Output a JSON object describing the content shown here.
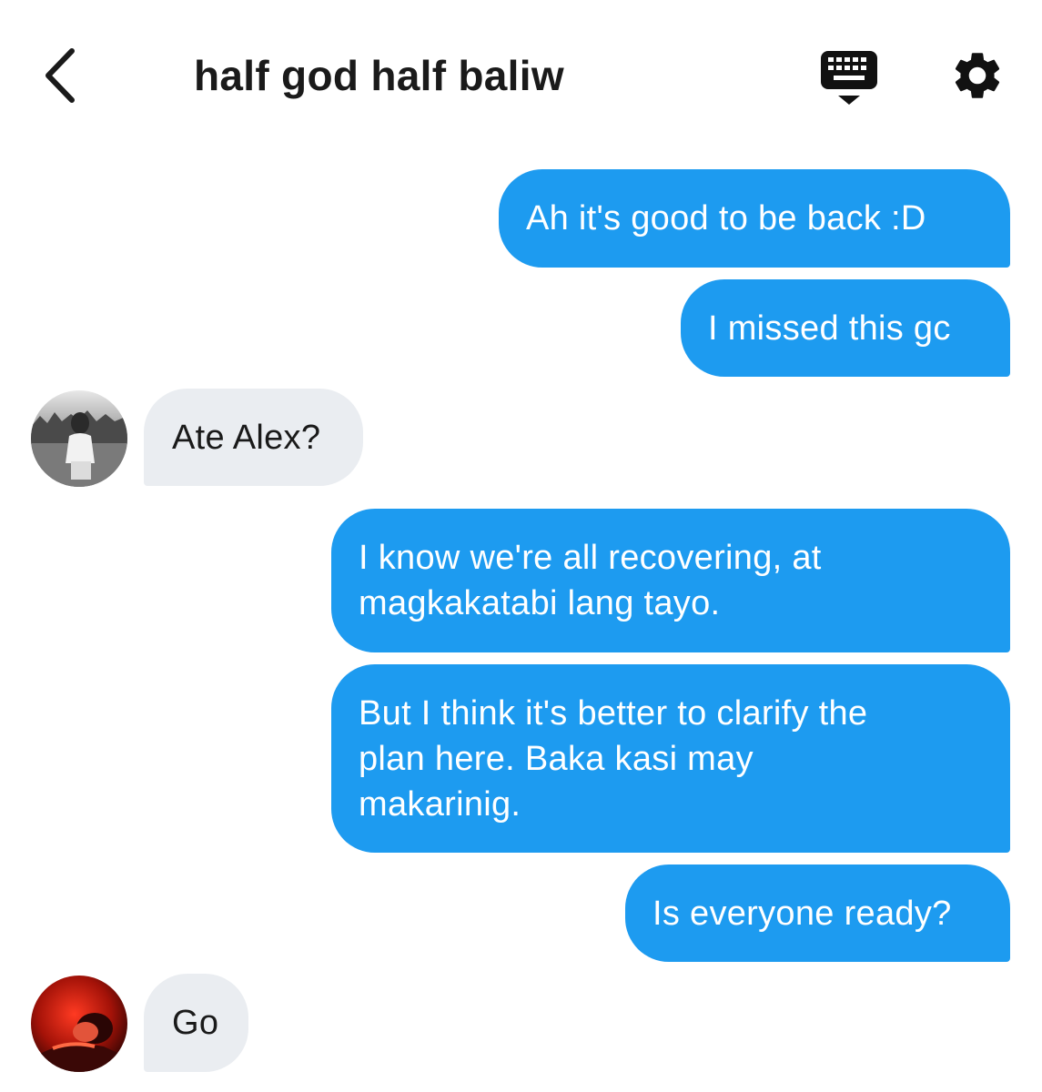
{
  "header": {
    "title": "half god half baliw",
    "back_icon": "chevron-left-icon",
    "keyboard_icon": "keyboard-icon",
    "settings_icon": "gear-icon"
  },
  "colors": {
    "outgoing_bubble": "#1d9bf0",
    "incoming_bubble": "#eaedf1",
    "text_dark": "#1a1a1a"
  },
  "messages": [
    {
      "direction": "outgoing",
      "text": "Ah it's good to be back :D"
    },
    {
      "direction": "outgoing",
      "text": "I missed this gc"
    },
    {
      "direction": "incoming",
      "text": "Ate Alex?"
    },
    {
      "direction": "outgoing",
      "lines": [
        "I know we're all recovering, at",
        "magkakatabi lang tayo."
      ]
    },
    {
      "direction": "outgoing",
      "lines": [
        "But I think it's better to clarify the",
        "plan here. Baka kasi may",
        "makarinig."
      ]
    },
    {
      "direction": "outgoing",
      "text": "Is everyone ready?"
    },
    {
      "direction": "incoming",
      "text": "Go"
    }
  ]
}
